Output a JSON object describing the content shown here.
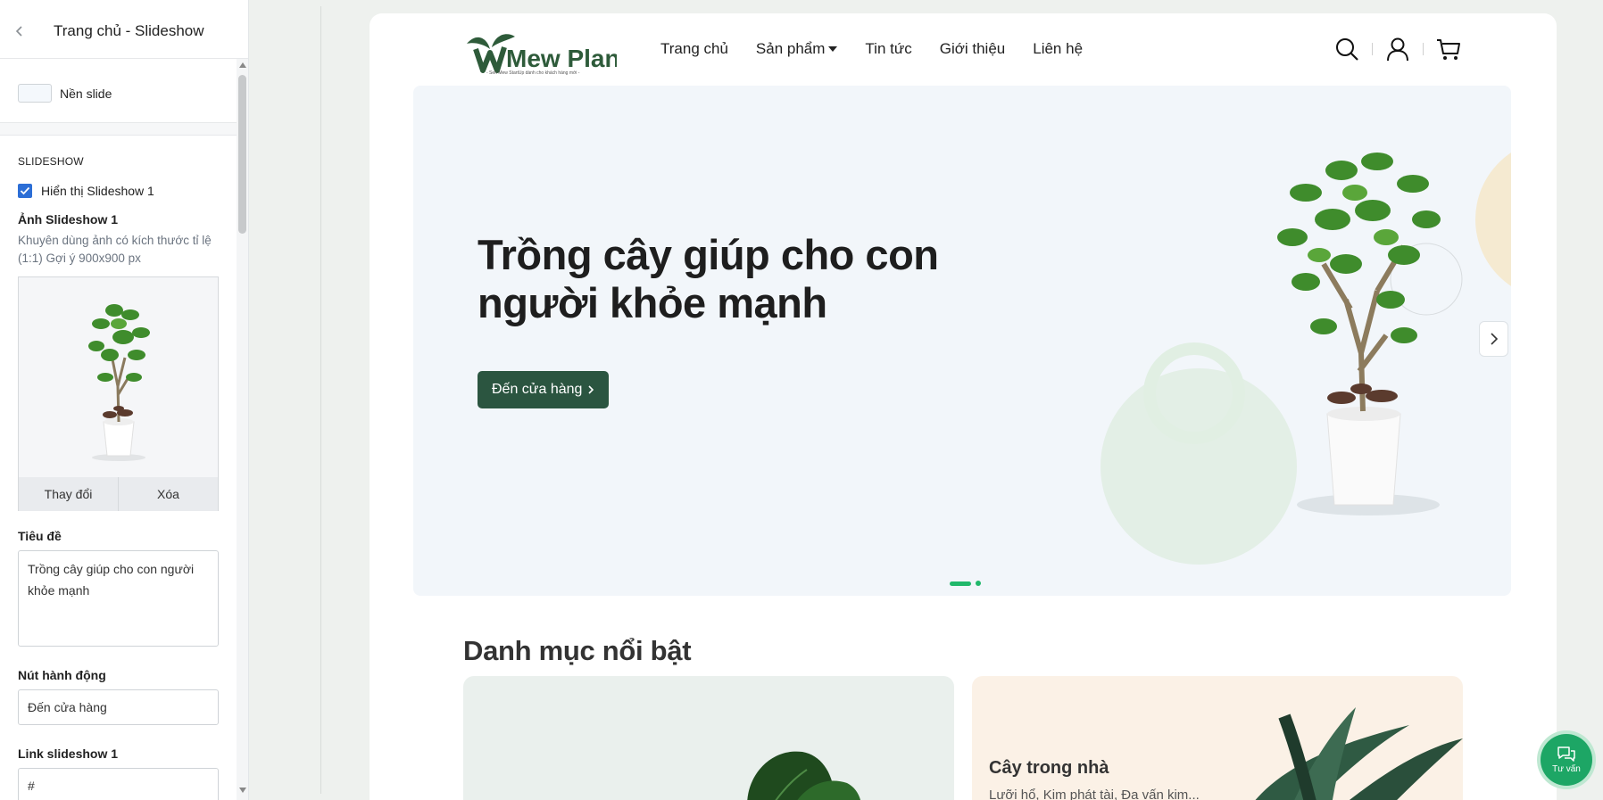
{
  "panel": {
    "title": "Trang chủ - Slideshow",
    "background_label": "Nền slide",
    "section_title": "SLIDESHOW",
    "show_slideshow_label": "Hiển thị Slideshow 1",
    "show_slideshow_checked": true,
    "image_label": "Ảnh Slideshow 1",
    "image_hint": "Khuyên dùng ảnh có kích thước tỉ lệ (1:1) Gợi ý 900x900 px",
    "change_button": "Thay đổi",
    "delete_button": "Xóa",
    "title_label": "Tiêu đề",
    "title_value": "Trồng cây giúp cho con người khỏe mạnh",
    "action_label": "Nút hành động",
    "action_value": "Đến cửa hàng",
    "link_label": "Link slideshow 1",
    "link_value": "#"
  },
  "site": {
    "logo_text": "Mew Plant",
    "logo_tagline": "- Sen Mew StartUp dành cho khách hàng mới -",
    "menu": [
      "Trang chủ",
      "Sản phẩm",
      "Tin tức",
      "Giới thiệu",
      "Liên hệ"
    ],
    "hero": {
      "title": "Trồng cây giúp cho con người khỏe mạnh",
      "button": "Đến cửa hàng",
      "slides": 2,
      "active_slide": 1
    },
    "categories_title": "Danh mục nổi bật",
    "card2": {
      "title": "Cây trong nhà",
      "desc": "Lưỡi hổ, Kim phát tài, Đa vấn kim..."
    },
    "chat_label": "Tư vấn"
  },
  "colors": {
    "accent": "#2b5540",
    "green": "#21b86b",
    "checkbox": "#2c6ed6"
  },
  "icons": [
    "chevron-left-icon",
    "search-icon",
    "user-icon",
    "cart-icon",
    "chevron-right-icon",
    "chat-icon"
  ]
}
